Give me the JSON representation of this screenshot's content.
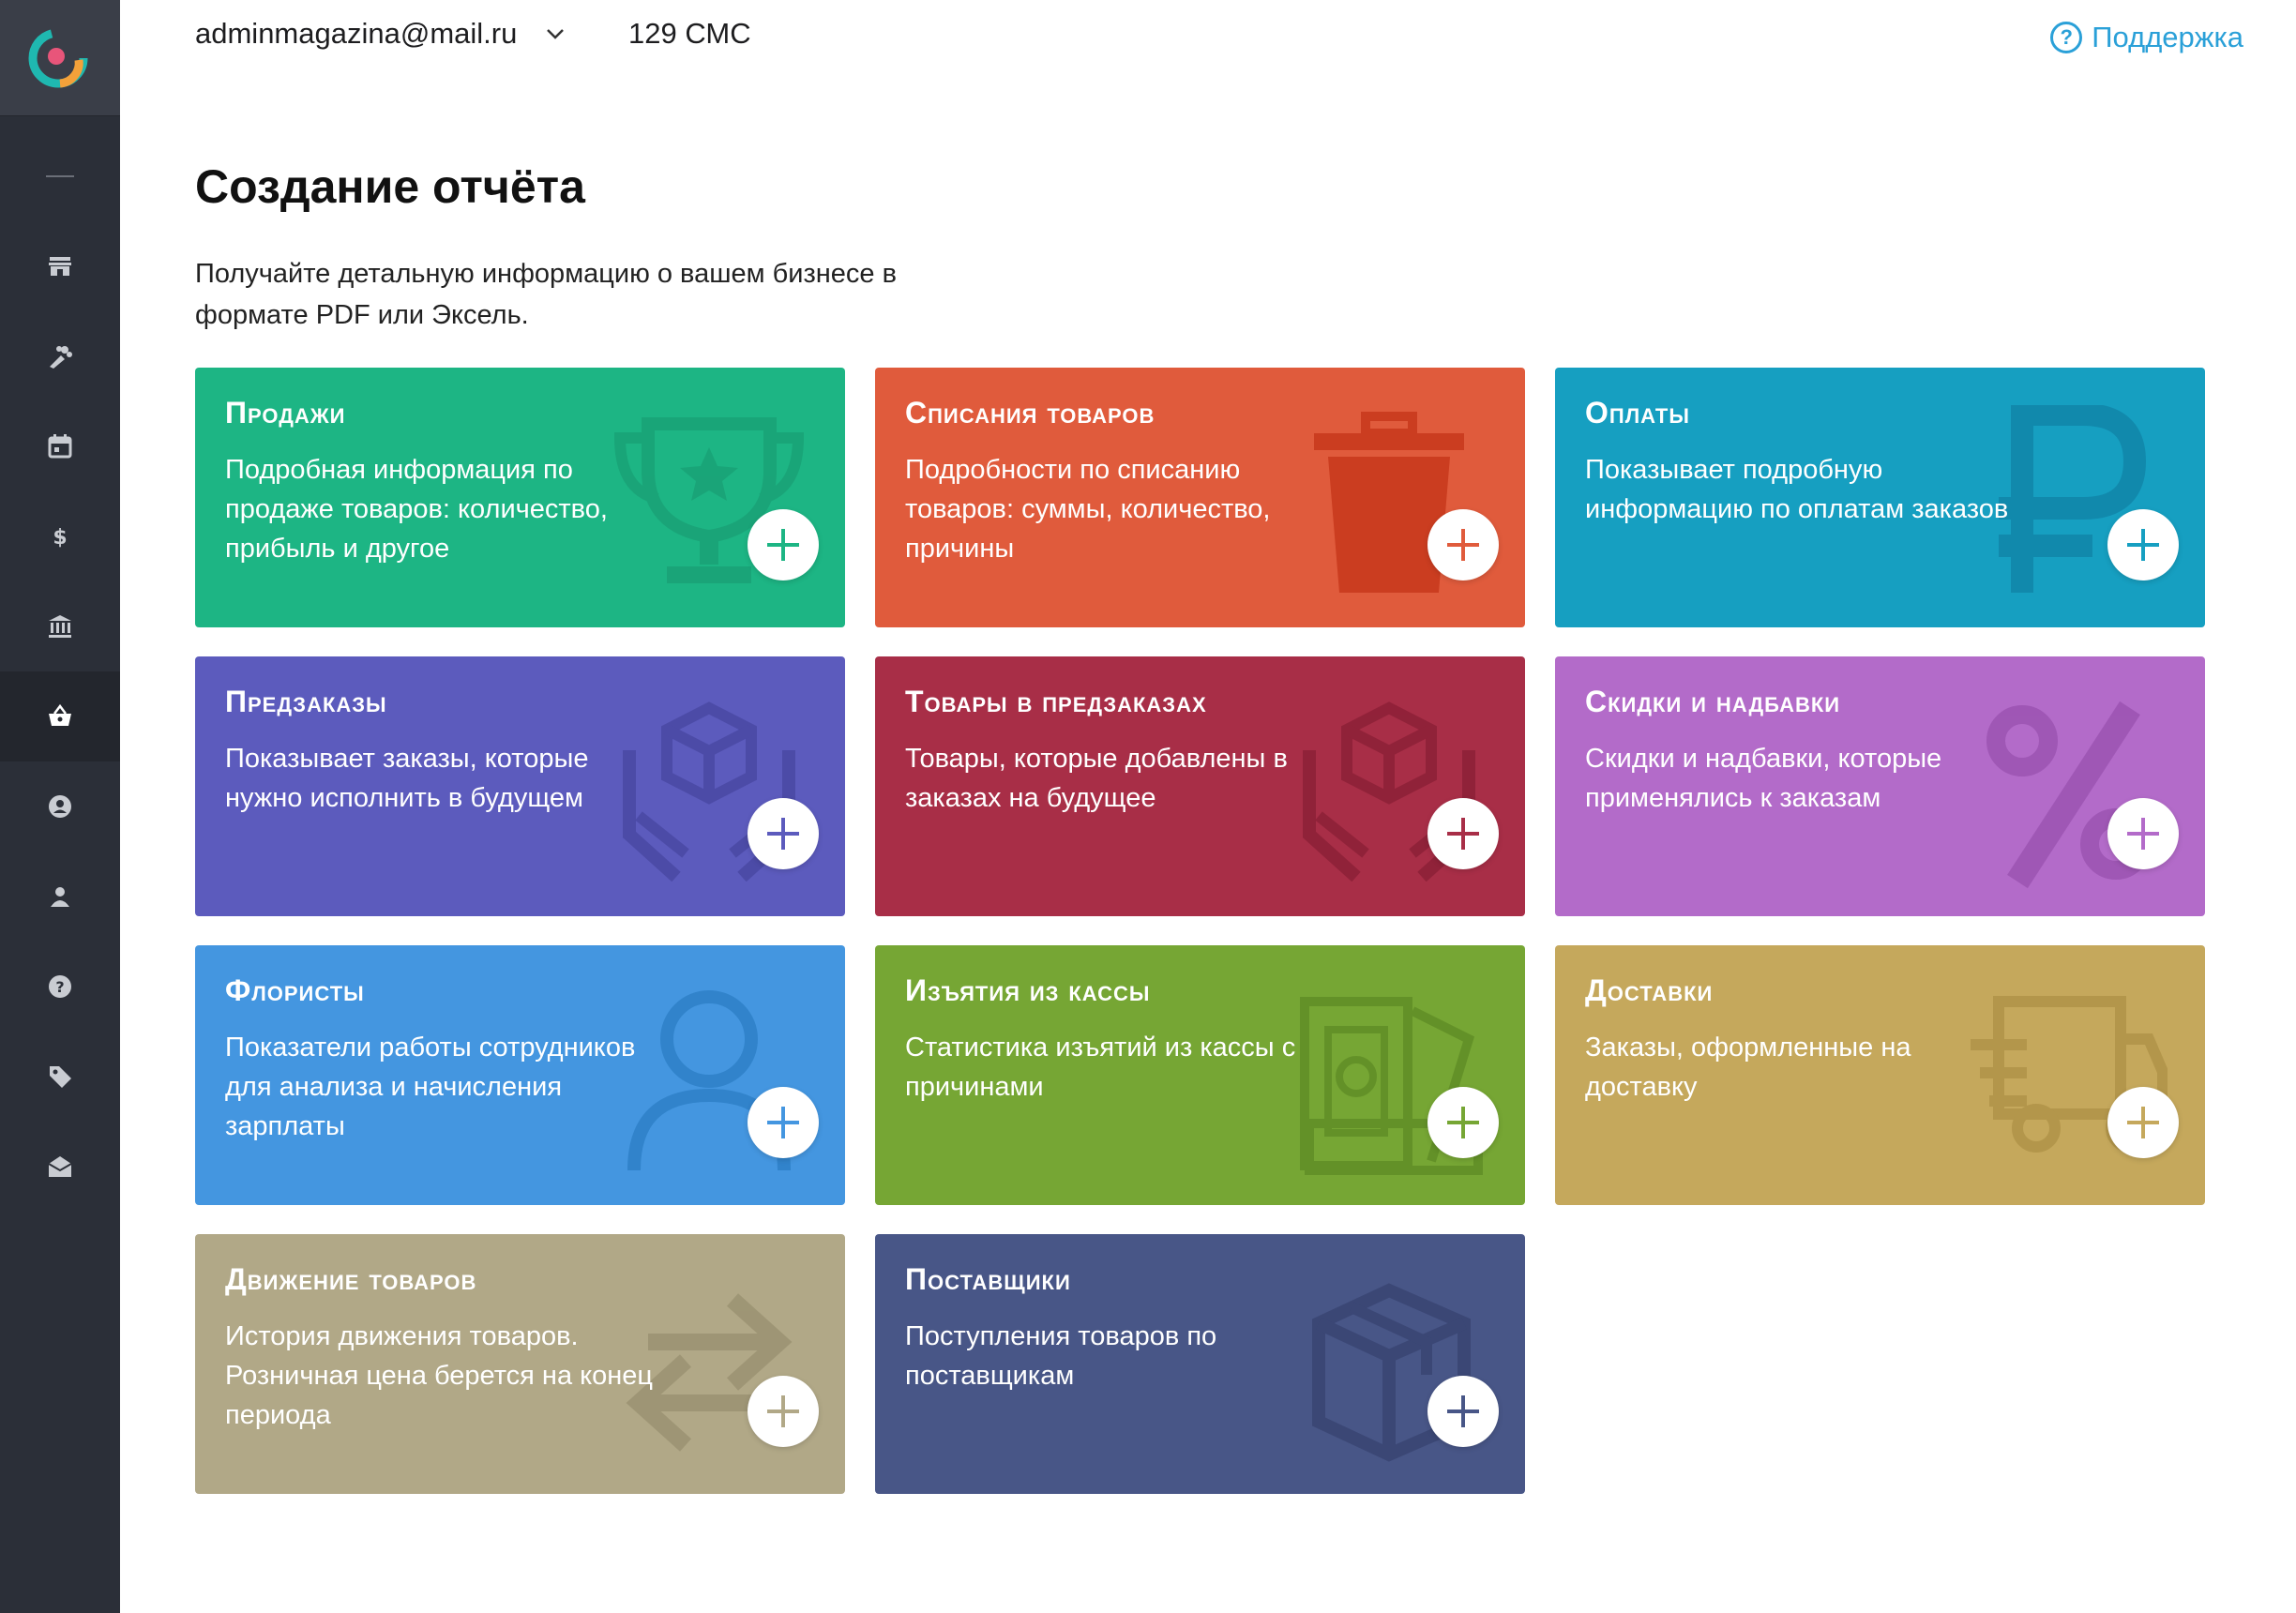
{
  "header": {
    "account_email": "adminmagazina@mail.ru",
    "sms_count": "129 СМС",
    "support_label": "Поддержка"
  },
  "page": {
    "title": "Создание отчёта",
    "subtitle": "Получайте детальную информацию о вашем бизнесе в формате PDF или Эксель."
  },
  "sidebar": {
    "items": [
      {
        "name": "collapse-icon"
      },
      {
        "name": "store-icon"
      },
      {
        "name": "bouquet-icon"
      },
      {
        "name": "calendar-icon"
      },
      {
        "name": "dollar-icon"
      },
      {
        "name": "bank-icon"
      },
      {
        "name": "basket-icon",
        "active": true
      },
      {
        "name": "user-circle-icon"
      },
      {
        "name": "person-icon"
      },
      {
        "name": "help-icon"
      },
      {
        "name": "tag-icon"
      },
      {
        "name": "mail-icon"
      }
    ]
  },
  "cards": [
    {
      "title": "Продажи",
      "desc": "Подробная информация по продаже товаров: количество, прибыль и другое",
      "color": "#1db584",
      "accent": "#1aa377",
      "icon": "trophy-icon"
    },
    {
      "title": "Списания товаров",
      "desc": "Подробности по списанию товаров: суммы, количество, причины",
      "color": "#e05b3c",
      "accent": "#c93a1d",
      "icon": "trash-icon"
    },
    {
      "title": "Оплаты",
      "desc": "Показывает подробную информацию по оплатам заказов",
      "color": "#169fc1",
      "accent": "#1187aa",
      "icon": "ruble-icon"
    },
    {
      "title": "Предзаказы",
      "desc": "Показывает заказы, которые нужно исполнить в будущем",
      "color": "#5c5bbd",
      "accent": "#4b4aa5",
      "icon": "box-hands-icon"
    },
    {
      "title": "Товары в предзаказах",
      "desc": "Товары, которые добавлены в заказах на будущее",
      "color": "#a82e47",
      "accent": "#8e2138",
      "icon": "box-hands-icon"
    },
    {
      "title": "Скидки и надбавки",
      "desc": "Скидки и надбавки, которые применялись к заказам",
      "color": "#b36bc9",
      "accent": "#9d55b3",
      "icon": "percent-icon"
    },
    {
      "title": "Флористы",
      "desc": "Показатели работы сотрудников для анализа и начисления зарплаты",
      "color": "#4496e0",
      "accent": "#2f82c9",
      "icon": "person-outline-icon"
    },
    {
      "title": "Изъятия из кассы",
      "desc": "Статистика изъятий из кассы с причинами",
      "color": "#76a634",
      "accent": "#628f27",
      "icon": "cash-icon"
    },
    {
      "title": "Доставки",
      "desc": "Заказы, оформленные на доставку",
      "color": "#c5a85c",
      "accent": "#b2954a",
      "icon": "truck-icon"
    },
    {
      "title": "Движение товаров",
      "desc": "История движения товаров. Розничная цена берется на конец периода",
      "color": "#b1a887",
      "accent": "#9d9474",
      "icon": "arrows-icon"
    },
    {
      "title": "Поставщики",
      "desc": "Поступления товаров по поставщикам",
      "color": "#485687",
      "accent": "#3a4674",
      "icon": "package-icon"
    }
  ]
}
